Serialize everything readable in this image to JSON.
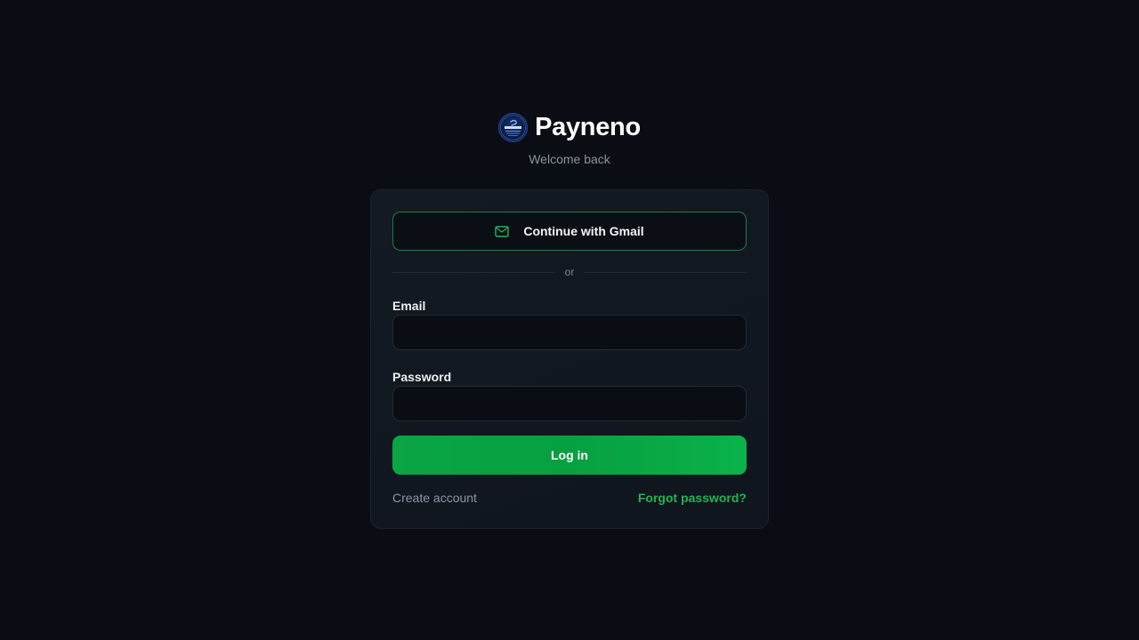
{
  "brand": {
    "name": "Payneno",
    "logo_icon": "payneno-logo-icon",
    "subtitle": "Welcome back"
  },
  "login_card": {
    "gmail_button": {
      "label": "Continue with Gmail",
      "icon": "mail-icon"
    },
    "divider_text": "or",
    "email": {
      "label": "Email",
      "value": "",
      "placeholder": ""
    },
    "password": {
      "label": "Password",
      "value": "",
      "placeholder": ""
    },
    "login_button": {
      "label": "Log in"
    },
    "create_account_link": "Create account",
    "forgot_password_link": "Forgot password?"
  },
  "colors": {
    "background": "#0a0d14",
    "card": "#121820",
    "accent_green": "#0aa544",
    "link_green": "#1eb553",
    "muted_text": "#8a93a3"
  }
}
